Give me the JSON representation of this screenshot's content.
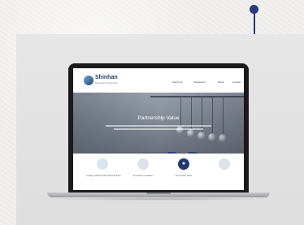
{
  "website": {
    "logo": {
      "name": "Shinhan",
      "tagline": "Financial Investment"
    },
    "nav": [
      {
        "label": "About Us"
      },
      {
        "label": "Investment"
      },
      {
        "label": "News"
      },
      {
        "label": "Contact"
      }
    ],
    "hero": {
      "title": "Partnership Value"
    },
    "features": [
      {
        "label": "Leading Global & Wise Bank Solution",
        "icon": "circle-icon"
      },
      {
        "label": "Securities Foundation",
        "icon": "circle-icon"
      },
      {
        "label": "Partnership Value",
        "icon": "people-icon",
        "active": true
      },
      {
        "label": "",
        "icon": "circle-icon"
      }
    ]
  },
  "colors": {
    "accent": "#2c3e86",
    "pin": "#2a3a7c",
    "brand": "#1f3c64"
  }
}
